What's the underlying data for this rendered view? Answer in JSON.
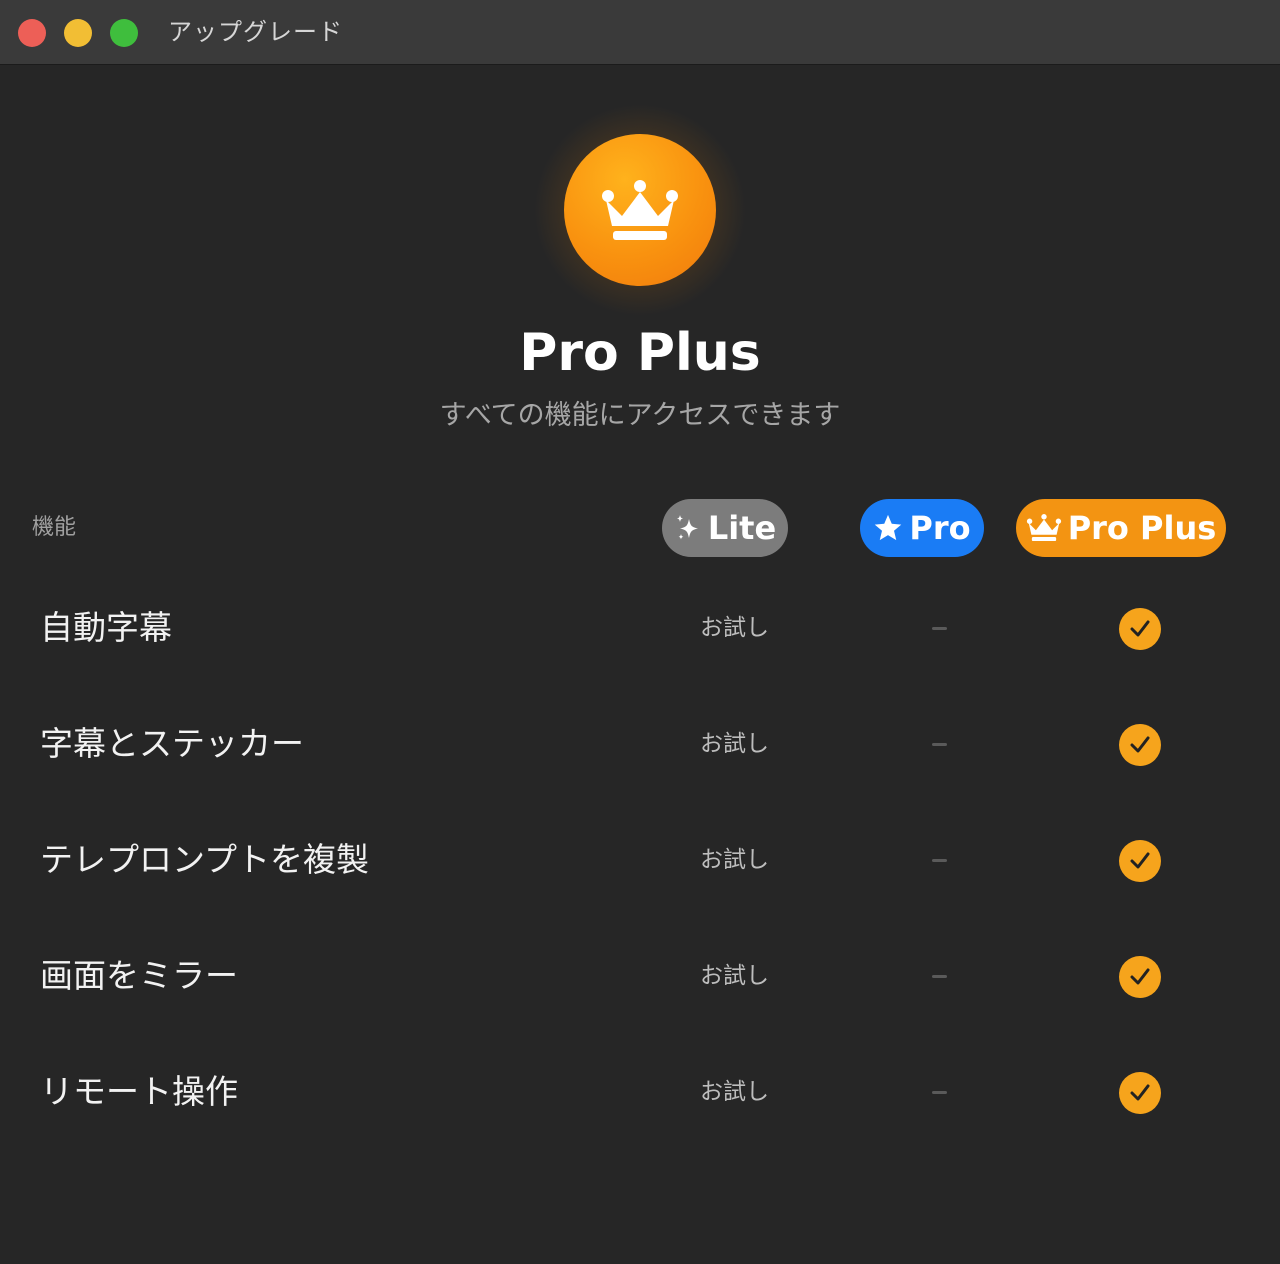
{
  "window": {
    "title": "アップグレード"
  },
  "hero": {
    "icon": "crown-icon",
    "title": "Pro Plus",
    "subtitle": "すべての機能にアクセスできます"
  },
  "table": {
    "feature_header": "機能",
    "plans": [
      {
        "label": "Lite",
        "icon": "sparkles-icon",
        "color": "#7c7c7c"
      },
      {
        "label": "Pro",
        "icon": "star-icon",
        "color": "#1a7cf5"
      },
      {
        "label": "Pro Plus",
        "icon": "crown-icon",
        "color": "#f39412"
      }
    ],
    "rows": [
      {
        "feature": "自動字幕",
        "lite": "お試し",
        "pro": "–",
        "pro_plus": "check"
      },
      {
        "feature": "字幕とステッカー",
        "lite": "お試し",
        "pro": "–",
        "pro_plus": "check"
      },
      {
        "feature": "テレプロンプトを複製",
        "lite": "お試し",
        "pro": "–",
        "pro_plus": "check"
      },
      {
        "feature": "画面をミラー",
        "lite": "お試し",
        "pro": "–",
        "pro_plus": "check"
      },
      {
        "feature": "リモート操作",
        "lite": "お試し",
        "pro": "–",
        "pro_plus": "check"
      }
    ]
  },
  "colors": {
    "accent": "#f6a41c",
    "background": "#262626",
    "pro_blue": "#1a7cf5"
  }
}
